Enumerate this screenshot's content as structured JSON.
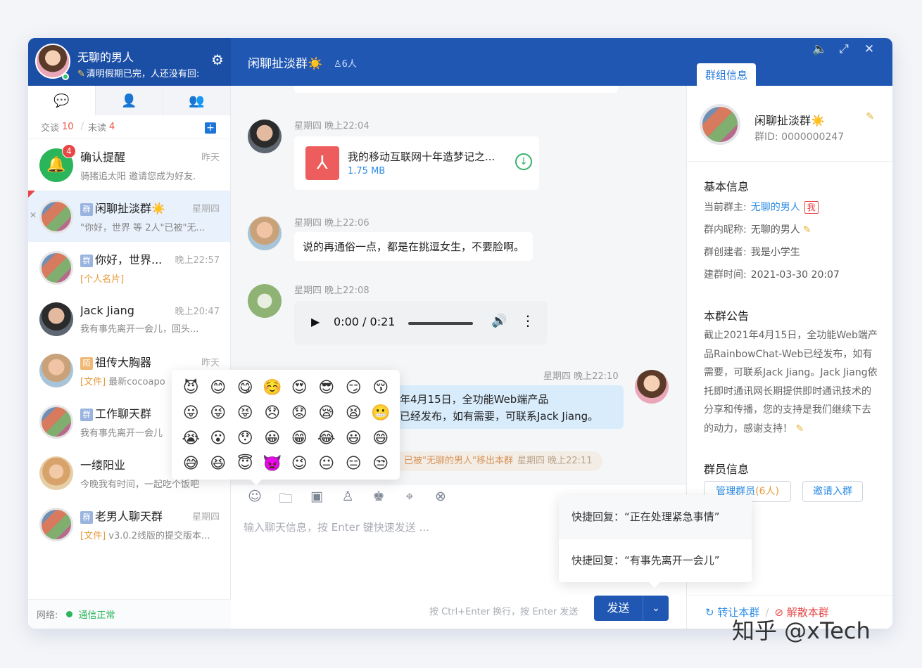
{
  "user": {
    "name": "无聊的男人",
    "status": "清明假期已完，人还没有回:"
  },
  "chat": {
    "title": "闲聊扯淡群☀️",
    "member_count": "6人"
  },
  "window_icons": [
    "speaker-icon",
    "expand-icon",
    "close-icon"
  ],
  "left": {
    "tabs": [
      {
        "name": "tab-chats",
        "icon": "chat-bubble-icon"
      },
      {
        "name": "tab-friends",
        "icon": "contacts-icon"
      },
      {
        "name": "tab-groups",
        "icon": "group-icon"
      }
    ],
    "stats": {
      "chats_label": "交谈",
      "chats_count": "10",
      "separator": "/",
      "unread_label": "未读",
      "unread_count": "4"
    },
    "conversations": [
      {
        "name": "确认提醒",
        "time": "昨天",
        "preview": "骑猪追太阳 邀请您成为好友.",
        "badge": "4"
      },
      {
        "tag": "群",
        "name": "闲聊扯淡群☀️",
        "time": "星期四",
        "preview": "\"你好，世界 等 2人\"已被\"无..."
      },
      {
        "tag": "群",
        "name": "你好，世界...",
        "time": "晚上22:57",
        "preview_tag": "[个人名片]"
      },
      {
        "name": "Jack Jiang",
        "time": "晚上20:47",
        "preview": "我有事先离开一会儿，回头..."
      },
      {
        "tag": "陌",
        "name": "祖传大胸器",
        "time": "昨天",
        "preview_tag": "[文件]",
        "preview": " 最新cocoapo"
      },
      {
        "tag": "群",
        "name": "工作聊天群",
        "preview": "我有事先离开一会儿"
      },
      {
        "name": "一缕阳业",
        "preview": "今晚我有时间，一起吃个饭吧"
      },
      {
        "tag": "群",
        "name": "老男人聊天群",
        "time": "星期四",
        "preview_tag": "[文件]",
        "preview": " v3.0.2线版的提交版本..."
      }
    ],
    "network_label": "网络:",
    "network_status": "通信正常"
  },
  "messages": {
    "file_msg": {
      "time": "星期四 晚上22:04",
      "file_name": "我的移动互联网十年造梦记之...",
      "file_size": "1.75 MB"
    },
    "text_msg": {
      "time": "星期四 晚上22:06",
      "text": "说的再通俗一点，都是在挑逗女生，不要脸啊。"
    },
    "audio_msg": {
      "time": "星期四 晚上22:08",
      "current": "0:00",
      "sep": "/",
      "duration": "0:21"
    },
    "mine_msg": {
      "time": "星期四 晚上22:10",
      "line1": "年4月15日，全功能Web端产品",
      "line2": "已经发布，如有需要，可联系Jack Jiang。"
    },
    "system_msg": {
      "text": "已被\"无聊的男人\"移出本群",
      "time": "星期四 晚上22:11"
    }
  },
  "composer": {
    "toolbar": [
      "emoji-icon",
      "folder-icon",
      "image-icon",
      "contact-card-icon",
      "group-card-icon",
      "location-icon",
      "cancel-icon"
    ],
    "placeholder": "输入聊天信息，按 Enter 键快速发送 ...",
    "hint": "按 Ctrl+Enter 换行，按 Enter 发送",
    "send_label": "发送"
  },
  "emoji_list": [
    "😈",
    "😊",
    "😋",
    "☺️",
    "😍",
    "😎",
    "😏",
    "😚",
    "😛",
    "😜",
    "😝",
    "😞",
    "😟",
    "😪",
    "😫",
    "😬",
    "😭",
    "😮",
    "😯",
    "😀",
    "😁",
    "😂",
    "😃",
    "😄",
    "😅",
    "😆",
    "😇",
    "👿",
    "😉",
    "😐",
    "😑",
    "😒"
  ],
  "quick_replies": [
    "快捷回复：“正在处理紧急事情”",
    "快捷回复：“有事先离开一会儿”"
  ],
  "right": {
    "tab": "群组信息",
    "group_name": "闲聊扯淡群☀️",
    "group_id": "群ID: 0000000247",
    "basic_title": "基本信息",
    "owner_label": "当前群主:",
    "owner_value": "无聊的男人",
    "owner_me": "我",
    "nick_label": "群内昵称:",
    "nick_value": "无聊的男人",
    "creator_label": "群创建者:",
    "creator_value": "我是小学生",
    "created_label": "建群时间:",
    "created_value": "2021-03-30 20:07",
    "notice_title": "本群公告",
    "notice_text": "截止2021年4月15日，全功能Web端产品RainbowChat-Web已经发布，如有需要，可联系Jack Jiang。Jack Jiang依托即时通讯网长期提供即时通讯技术的分享和传播，您的支持是我们继续下去的动力，感谢支持！",
    "members_title": "群员信息",
    "manage_label": "管理群员",
    "manage_count": "(6人)",
    "invite_label": "邀请入群",
    "transfer_label": "转让本群",
    "footer_sep": "/",
    "dissolve_label": "解散本群"
  },
  "watermark": "知乎 @xTech"
}
